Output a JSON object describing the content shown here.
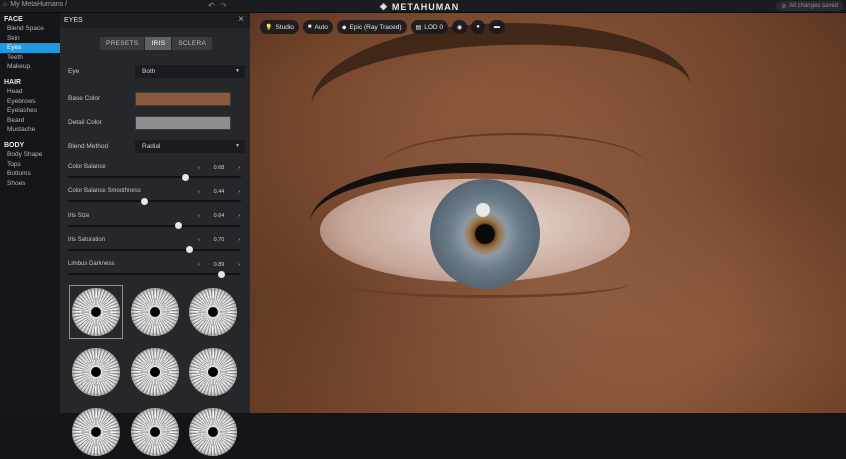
{
  "topbar": {
    "breadcrumb": "My MetaHumans /",
    "logo_text": "METAHUMAN",
    "status": "All changes saved",
    "undo_icon": "undo-icon",
    "redo_icon": "redo-icon"
  },
  "sidebar": {
    "sections": [
      {
        "title": "FACE",
        "items": [
          "Blend Space",
          "Skin",
          "Eyes",
          "Teeth",
          "Makeup"
        ]
      },
      {
        "title": "HAIR",
        "items": [
          "Head",
          "Eyebrows",
          "Eyelashes",
          "Beard",
          "Mustache"
        ]
      },
      {
        "title": "BODY",
        "items": [
          "Body Shape",
          "Tops",
          "Bottoms",
          "Shoes"
        ]
      }
    ],
    "active_item": "Eyes",
    "active_color": "#1e9be0"
  },
  "panel": {
    "title": "EYES",
    "tabs": [
      "PRESETS",
      "IRIS",
      "SCLERA"
    ],
    "active_tab": "IRIS",
    "eye_label": "Eye",
    "eye_value": "Both",
    "base_color_label": "Base Color",
    "base_color": "#8a5a3e",
    "detail_color_label": "Detail Color",
    "detail_color": "#8d8d8d",
    "blend_method_label": "Blend Method",
    "blend_method_value": "Radial",
    "sliders": [
      {
        "label": "Color Balance",
        "value": "0.68",
        "fraction": 0.68
      },
      {
        "label": "Color Balance Smoothness",
        "value": "0.44",
        "fraction": 0.44
      },
      {
        "label": "Iris Size",
        "value": "0.64",
        "fraction": 0.64
      },
      {
        "label": "Iris Saturation",
        "value": "0.70",
        "fraction": 0.7
      },
      {
        "label": "Limbus Darkness",
        "value": "0.89",
        "fraction": 0.89
      }
    ],
    "selected_iris": 0
  },
  "viewport": {
    "toolbar": [
      {
        "icon": "lightbulb-icon",
        "label": "Studio"
      },
      {
        "icon": "camera-icon",
        "label": "Auto"
      },
      {
        "icon": "diamond-icon",
        "label": "Epic (Ray Traced)"
      },
      {
        "icon": "lod-icon",
        "label": "LOD 0"
      },
      {
        "icon": "globe-icon",
        "label": ""
      },
      {
        "icon": "head-icon",
        "label": ""
      },
      {
        "icon": "grid-icon",
        "label": ""
      }
    ]
  }
}
